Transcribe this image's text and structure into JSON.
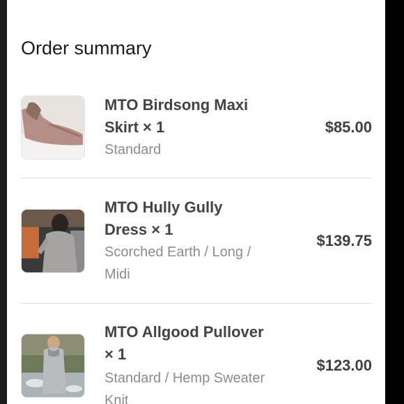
{
  "summary": {
    "title": "Order summary",
    "items": [
      {
        "name": "MTO Birdsong Maxi Skirt × 1",
        "variant": "Standard",
        "price": "$85.00"
      },
      {
        "name": "MTO Hully Gully Dress × 1",
        "variant": "Scorched Earth / Long / Midi",
        "price": "$139.75"
      },
      {
        "name": "MTO Allgood Pullover × 1",
        "variant": "Standard / Hemp Sweater Knit",
        "price": "$123.00"
      }
    ]
  }
}
